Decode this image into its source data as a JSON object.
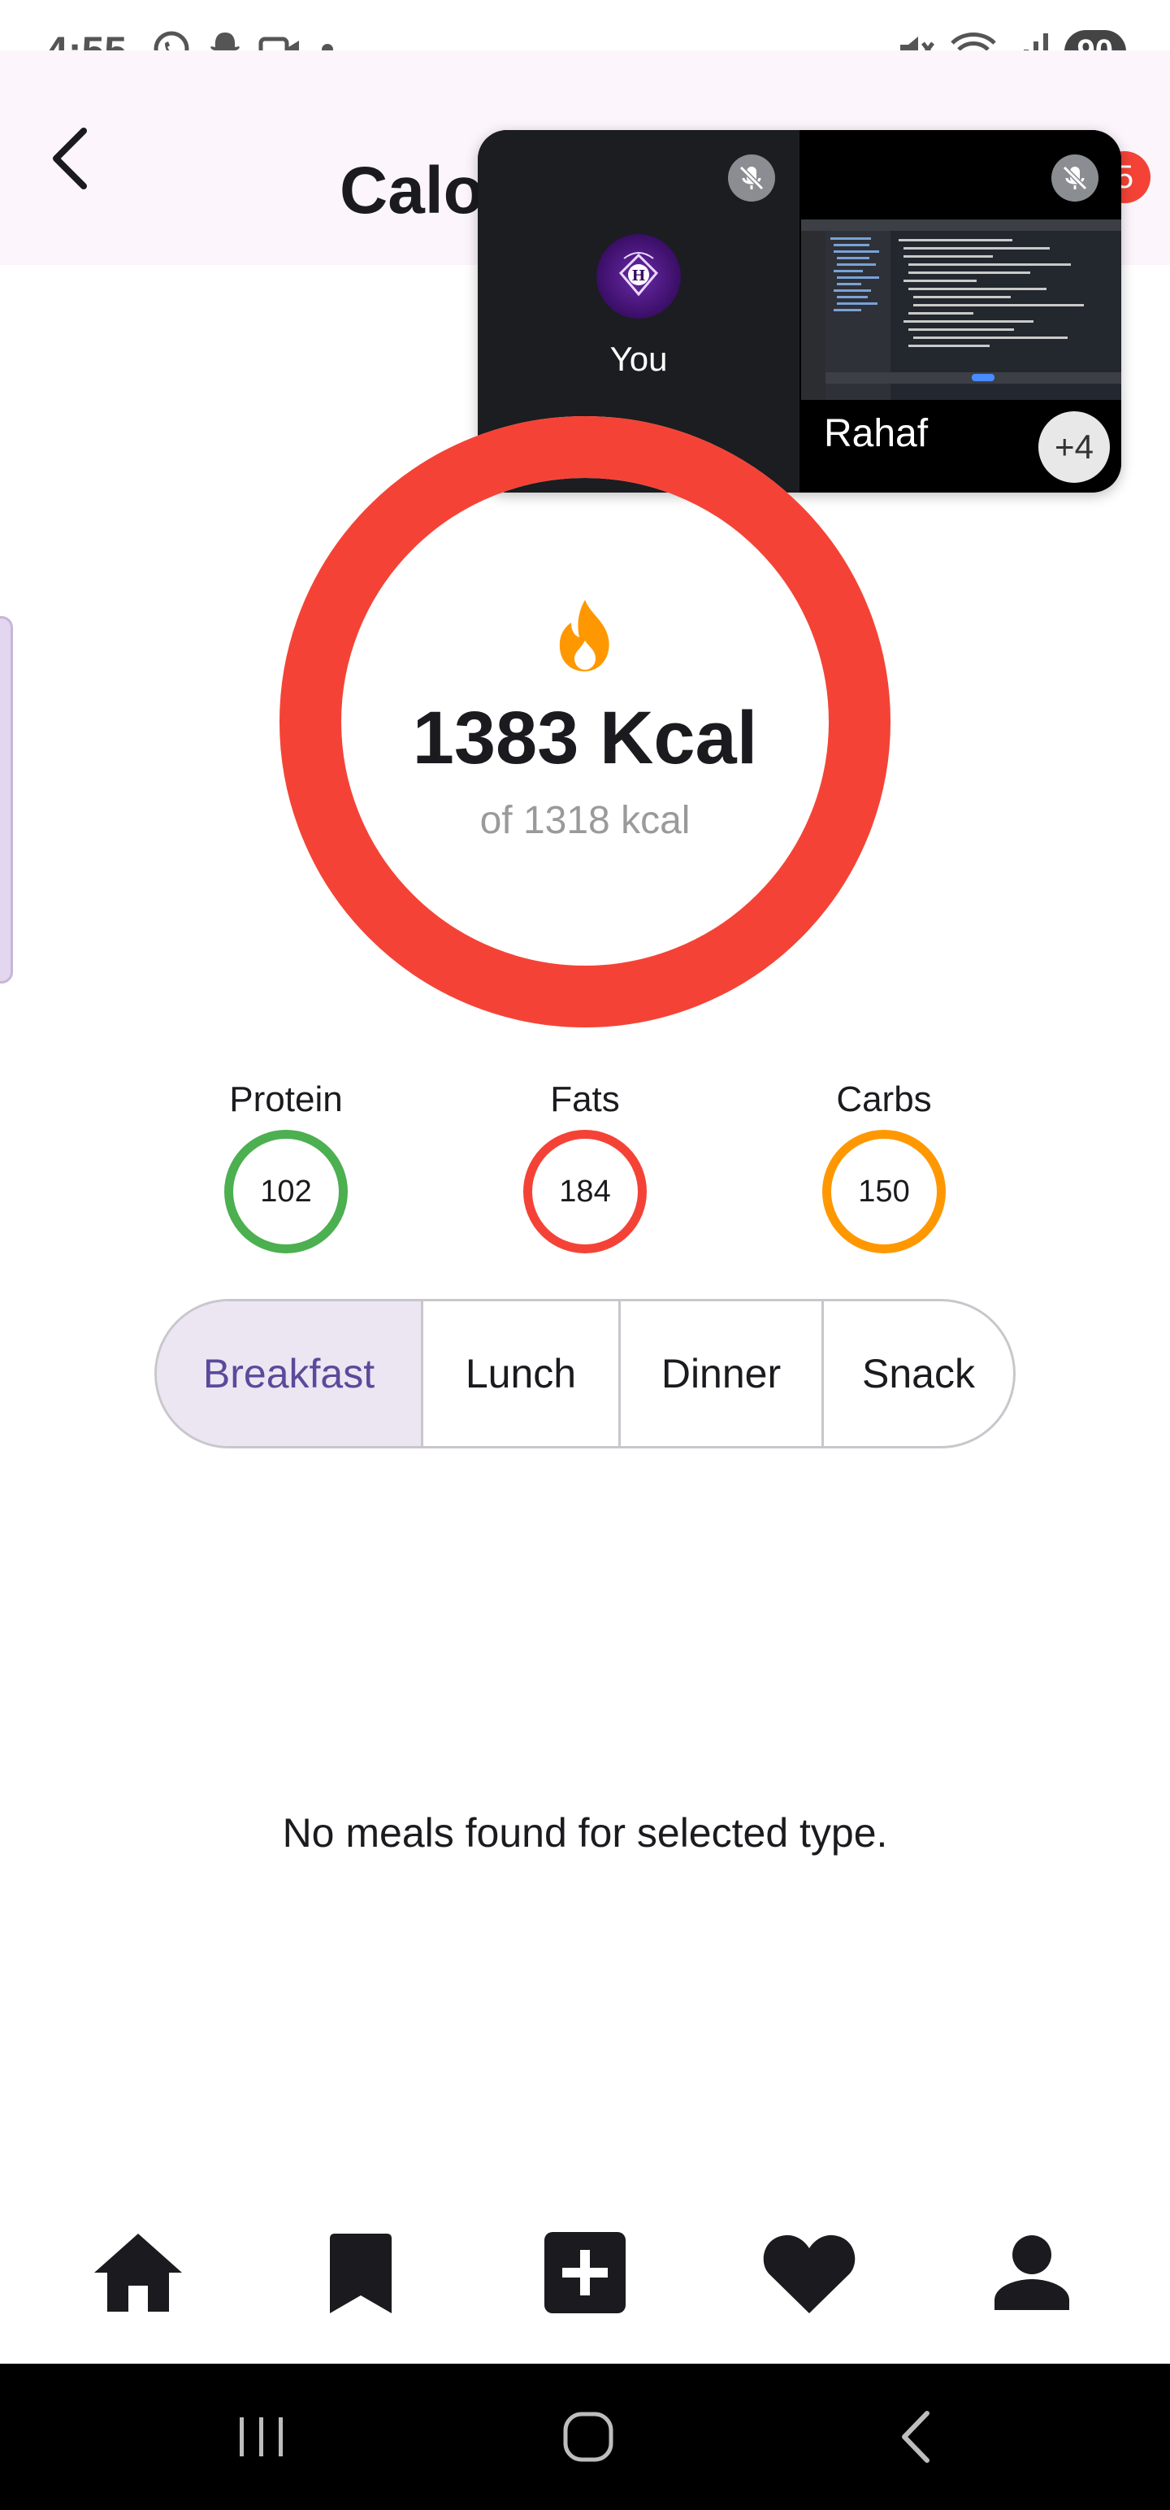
{
  "status_bar": {
    "time": "4:55",
    "battery": "90",
    "left_icons": [
      "whatsapp-icon",
      "snapchat-icon",
      "video-call-icon",
      "dot-icon"
    ],
    "right_icons": [
      "mute-icon",
      "wifi-icon",
      "signal-icon",
      "battery-icon"
    ]
  },
  "app_bar": {
    "title": "Calo",
    "back_icon": "chevron-left-icon",
    "badge_count": "5"
  },
  "call_overlay": {
    "self_label": "You",
    "participant_label": "Rahaf",
    "more_count": "+4",
    "avatar_letter": "H"
  },
  "calories": {
    "value": "1383 Kcal",
    "target": "of 1318 kcal",
    "consumed": 1383,
    "goal": 1318,
    "ring_color": "#f44336",
    "flame_color": "#ff9800"
  },
  "macros": [
    {
      "label": "Protein",
      "value": "102",
      "color": "#4caf50"
    },
    {
      "label": "Fats",
      "value": "184",
      "color": "#f44336"
    },
    {
      "label": "Carbs",
      "value": "150",
      "color": "#ff9800"
    }
  ],
  "meal_tabs": {
    "selected": "Breakfast",
    "items": [
      "Breakfast",
      "Lunch",
      "Dinner",
      "Snack"
    ]
  },
  "empty_state": "No meals found for selected type.",
  "bottom_nav": {
    "items": [
      "home-icon",
      "bookmark-icon",
      "add-box-icon",
      "heart-icon",
      "person-icon"
    ]
  },
  "system_nav": {
    "items": [
      "recent-apps-icon",
      "home-circle-icon",
      "back-icon"
    ]
  }
}
